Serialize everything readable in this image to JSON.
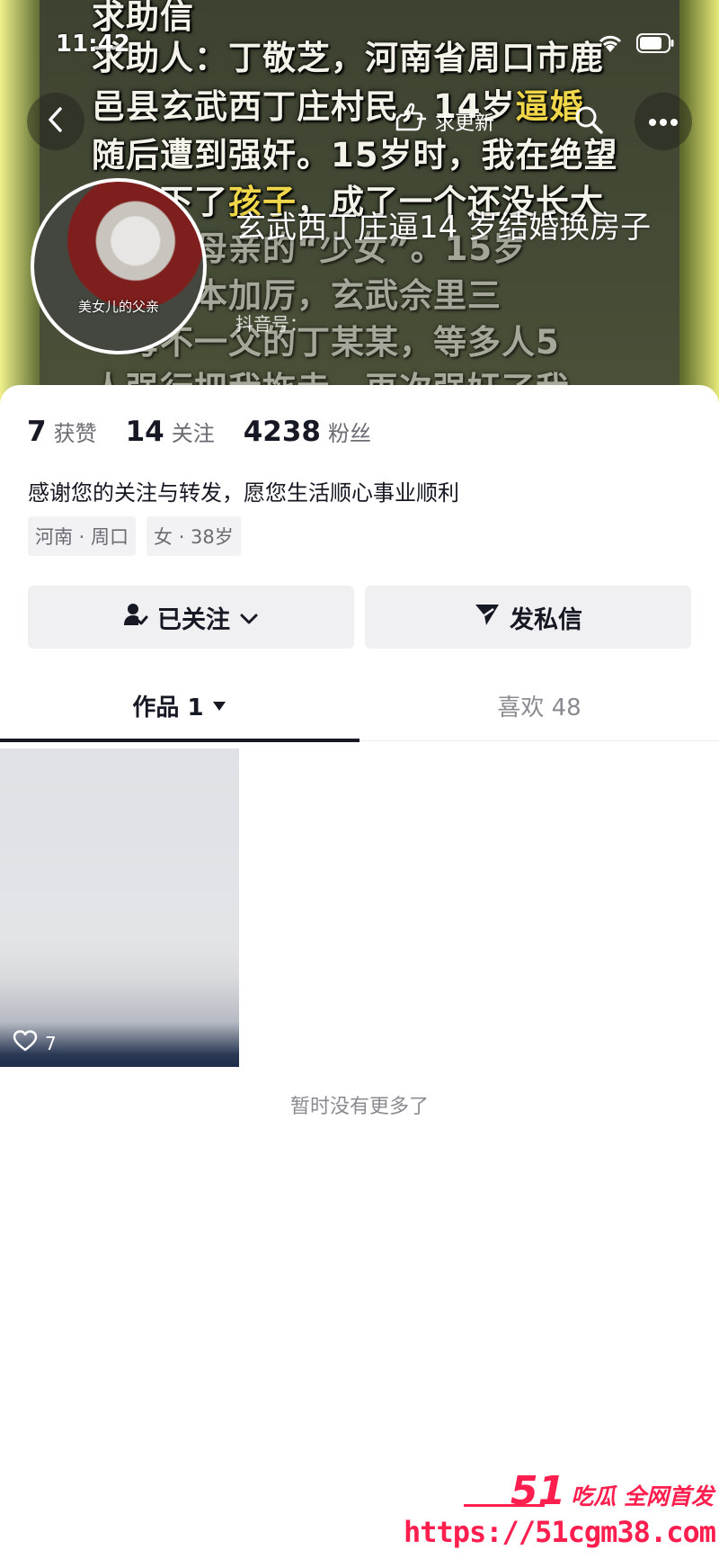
{
  "cover": {
    "lines": [
      "求助信",
      "求助人：丁敬芝，河南省周口市鹿",
      "邑县玄武西丁庄村民，14岁",
      "随后遭到强奸。15岁时，我在绝望",
      "中生下了",
      "，成了一个还没长大",
      "就成为母亲的“少女”。15岁",
      "他们变本加厉，玄武佘里三",
      "一母不一父的丁某某，等多人5",
      "人强行把我拖走，再次强奸了我"
    ],
    "highlight_1": "逼婚",
    "highlight_2": "孩子"
  },
  "status_bar": {
    "time": "11:42"
  },
  "header": {
    "update_label": "求更新"
  },
  "profile": {
    "name": "玄武西丁庄逼14 岁结婚换房子",
    "avatar_caption": "美女儿的父亲",
    "id_label": "抖音号：",
    "likes_count": "7",
    "likes_label": "获赞",
    "following_count": "14",
    "following_label": "关注",
    "followers_count": "4238",
    "followers_label": "粉丝",
    "bio": "感谢您的关注与转发，愿您生活顺心事业顺利",
    "tags": [
      "河南 · 周口",
      "女 · 38岁"
    ]
  },
  "actions": {
    "following_label": "已关注",
    "message_label": "发私信"
  },
  "tabs": {
    "works_label": "作品 1",
    "likes_label": "喜欢 48"
  },
  "video": {
    "likes": "7"
  },
  "footer": {
    "no_more": "暂时没有更多了"
  },
  "watermark": {
    "brand_big": "51",
    "brand_small": "吃瓜 全网首发",
    "url": "https://51cgm38.com"
  }
}
